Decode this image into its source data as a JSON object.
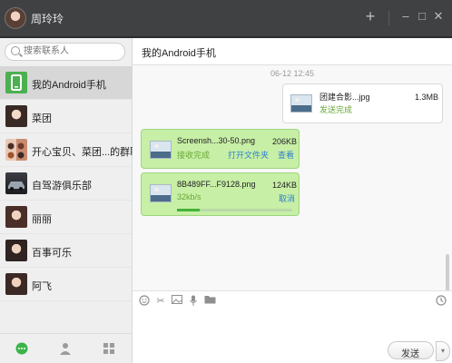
{
  "window": {
    "title": "周玲玲"
  },
  "sidebar": {
    "search_placeholder": "搜索联系人",
    "contacts": [
      {
        "name": "我的Android手机",
        "active": true
      },
      {
        "name": "菜团"
      },
      {
        "name": "开心宝贝、菜团...的群聊"
      },
      {
        "name": "自驾游俱乐部"
      },
      {
        "name": "丽丽"
      },
      {
        "name": "百事可乐"
      },
      {
        "name": "阿飞"
      }
    ]
  },
  "chat": {
    "title": "我的Android手机",
    "timestamp": "06-12 12:45",
    "messages": [
      {
        "direction": "in",
        "file": "团建合影...jpg",
        "size": "1.3MB",
        "status": "发送完成"
      },
      {
        "direction": "out",
        "file": "Screensh...30-50.png",
        "size": "206KB",
        "status": "接收完成",
        "link1": "打开文件夹",
        "link2": "查看"
      },
      {
        "direction": "out",
        "file": "8B489FF...F9128.png",
        "size": "124KB",
        "status": "32kb/s",
        "link1": "取消",
        "progress": 0.2
      }
    ]
  },
  "composer": {
    "send_label": "发送",
    "send_arrow": "▾"
  }
}
